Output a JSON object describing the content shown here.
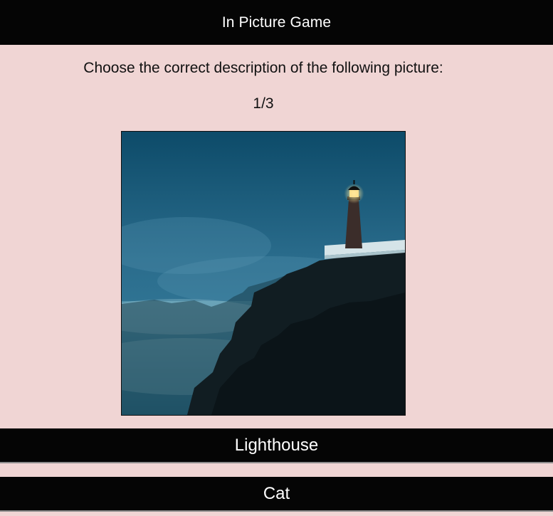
{
  "header": {
    "title": "In Picture Game"
  },
  "quiz": {
    "prompt": "Choose the correct description of the following picture:",
    "progress": "1/3",
    "picture": "lighthouse on rocky coast at dusk",
    "answers": [
      {
        "label": "Lighthouse"
      },
      {
        "label": "Cat"
      }
    ]
  },
  "colors": {
    "background": "#f0d5d4",
    "bar": "#050505",
    "bar_text": "#ffffff"
  }
}
